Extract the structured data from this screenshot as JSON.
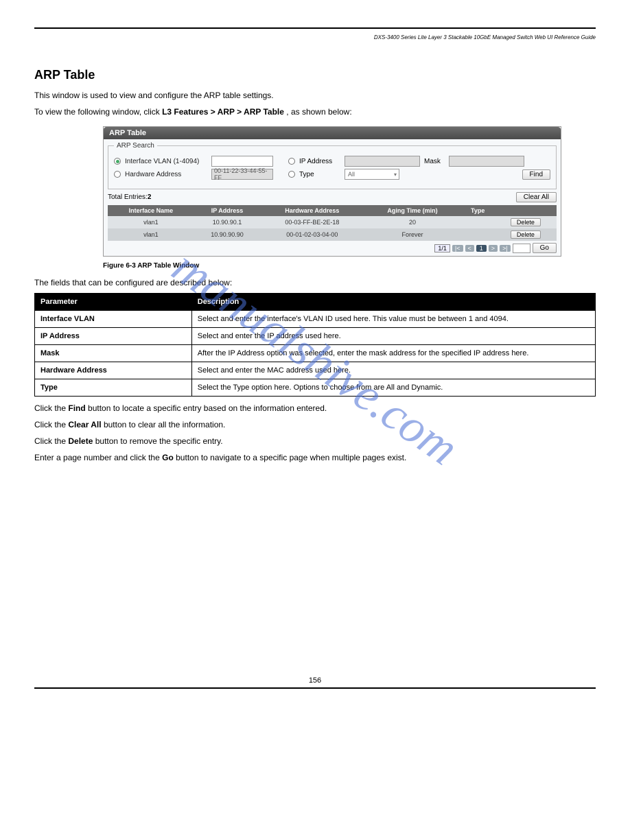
{
  "header": {
    "product_title": "DXS-3400 Series Lite Layer 3 Stackable 10GbE Managed Switch Web UI Reference Guide"
  },
  "watermark": "manualshive.com",
  "section": {
    "title": "ARP Table",
    "intro": "This window is used to view and configure the ARP table settings.",
    "nav_prefix": "To view the following window, click ",
    "nav_path": "L3 Features > ARP > ARP Table",
    "nav_suffix": ", as shown below:"
  },
  "shot": {
    "title": "ARP Table",
    "legend": "ARP Search",
    "radio_vlan_label": "Interface VLAN (1-4094)",
    "radio_ip_label": "IP Address",
    "mask_label": "Mask",
    "radio_hw_label": "Hardware Address",
    "hw_placeholder": "00-11-22-33-44-55-FF",
    "radio_type_label": "Type",
    "type_value": "All",
    "find_btn": "Find",
    "total_entries_label": "Total Entries: ",
    "total_entries_value": "2",
    "clear_all_btn": "Clear All",
    "cols": [
      "Interface Name",
      "IP Address",
      "Hardware Address",
      "Aging Time (min)",
      "Type",
      ""
    ],
    "rows": [
      {
        "iface": "vlan1",
        "ip": "10.90.90.1",
        "hw": "00-03-FF-BE-2E-18",
        "age": "20",
        "type": "",
        "btn": "Delete"
      },
      {
        "iface": "vlan1",
        "ip": "10.90.90.90",
        "hw": "00-01-02-03-04-00",
        "age": "Forever",
        "type": "",
        "btn": "Delete"
      }
    ],
    "pager": {
      "indicator": "1/1",
      "first": "|<",
      "prev": "<",
      "cur": "1",
      "next": ">",
      "last": ">|",
      "go": "Go"
    }
  },
  "figcap": "Figure 6-3 ARP Table Window",
  "desc_para": "The fields that can be configured are described below:",
  "params": {
    "h1": "Parameter",
    "h2": "Description",
    "rows": [
      {
        "p": "Interface VLAN",
        "d": "Select and enter the interface's VLAN ID used here. This value must be between 1 and 4094."
      },
      {
        "p": "IP Address",
        "d": "Select and enter the IP address used here."
      },
      {
        "p": "Mask",
        "d": "After the IP Address option was selected, enter the mask address for the specified IP address here."
      },
      {
        "p": "Hardware Address",
        "d": "Select and enter the MAC address used here."
      },
      {
        "p": "Type",
        "d": "Select the Type option here. Options to choose from are All and Dynamic."
      }
    ]
  },
  "actions": [
    {
      "prefix": "Click the ",
      "btn": "Find",
      "suffix": " button to locate a specific entry based on the information entered."
    },
    {
      "prefix": "Click the ",
      "btn": "Clear All",
      "suffix": " button to clear all the information."
    },
    {
      "prefix": "Click the ",
      "btn": "Delete",
      "suffix": " button to remove the specific entry."
    },
    {
      "prefix": "Enter a page number and click the ",
      "btn": "Go",
      "suffix": " button to navigate to a specific page when multiple pages exist."
    }
  ],
  "page_number": "156"
}
